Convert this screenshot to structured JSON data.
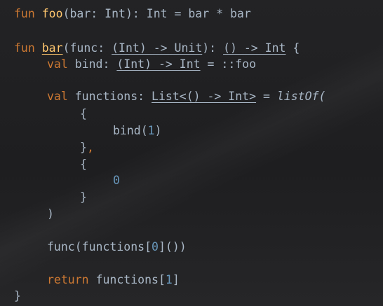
{
  "code": {
    "l1": {
      "kw": "fun",
      "name": "foo",
      "rest": "(bar: Int): Int = bar * bar"
    },
    "l2": {
      "kw": "fun",
      "name": "bar",
      "p1": "(func: ",
      "t1": "(Int) -> Unit",
      "p2": "): ",
      "t2": "() -> Int",
      "p3": " {"
    },
    "l3": {
      "kw": "val",
      "p1": " bind: ",
      "t1": "(Int) -> Int",
      "p2": " = ::foo"
    },
    "l4": {
      "kw": "val",
      "p1": " functions: ",
      "t1": "List<() -> Int>",
      "p2": " = ",
      "call": "listOf("
    },
    "l5": {
      "text": "{"
    },
    "l6": {
      "p1": "bind(",
      "num": "1",
      "p2": ")"
    },
    "l7": {
      "p1": "}",
      "kw": ","
    },
    "l8": {
      "text": "{"
    },
    "l9": {
      "num": "0"
    },
    "l10": {
      "text": "}"
    },
    "l11": {
      "text": ")"
    },
    "l12": {
      "p1": "func(functions[",
      "num": "0",
      "p2": "]())"
    },
    "l13": {
      "kw": "return",
      "p1": " functions[",
      "num": "1",
      "p2": "]"
    },
    "l14": {
      "text": "}"
    }
  }
}
